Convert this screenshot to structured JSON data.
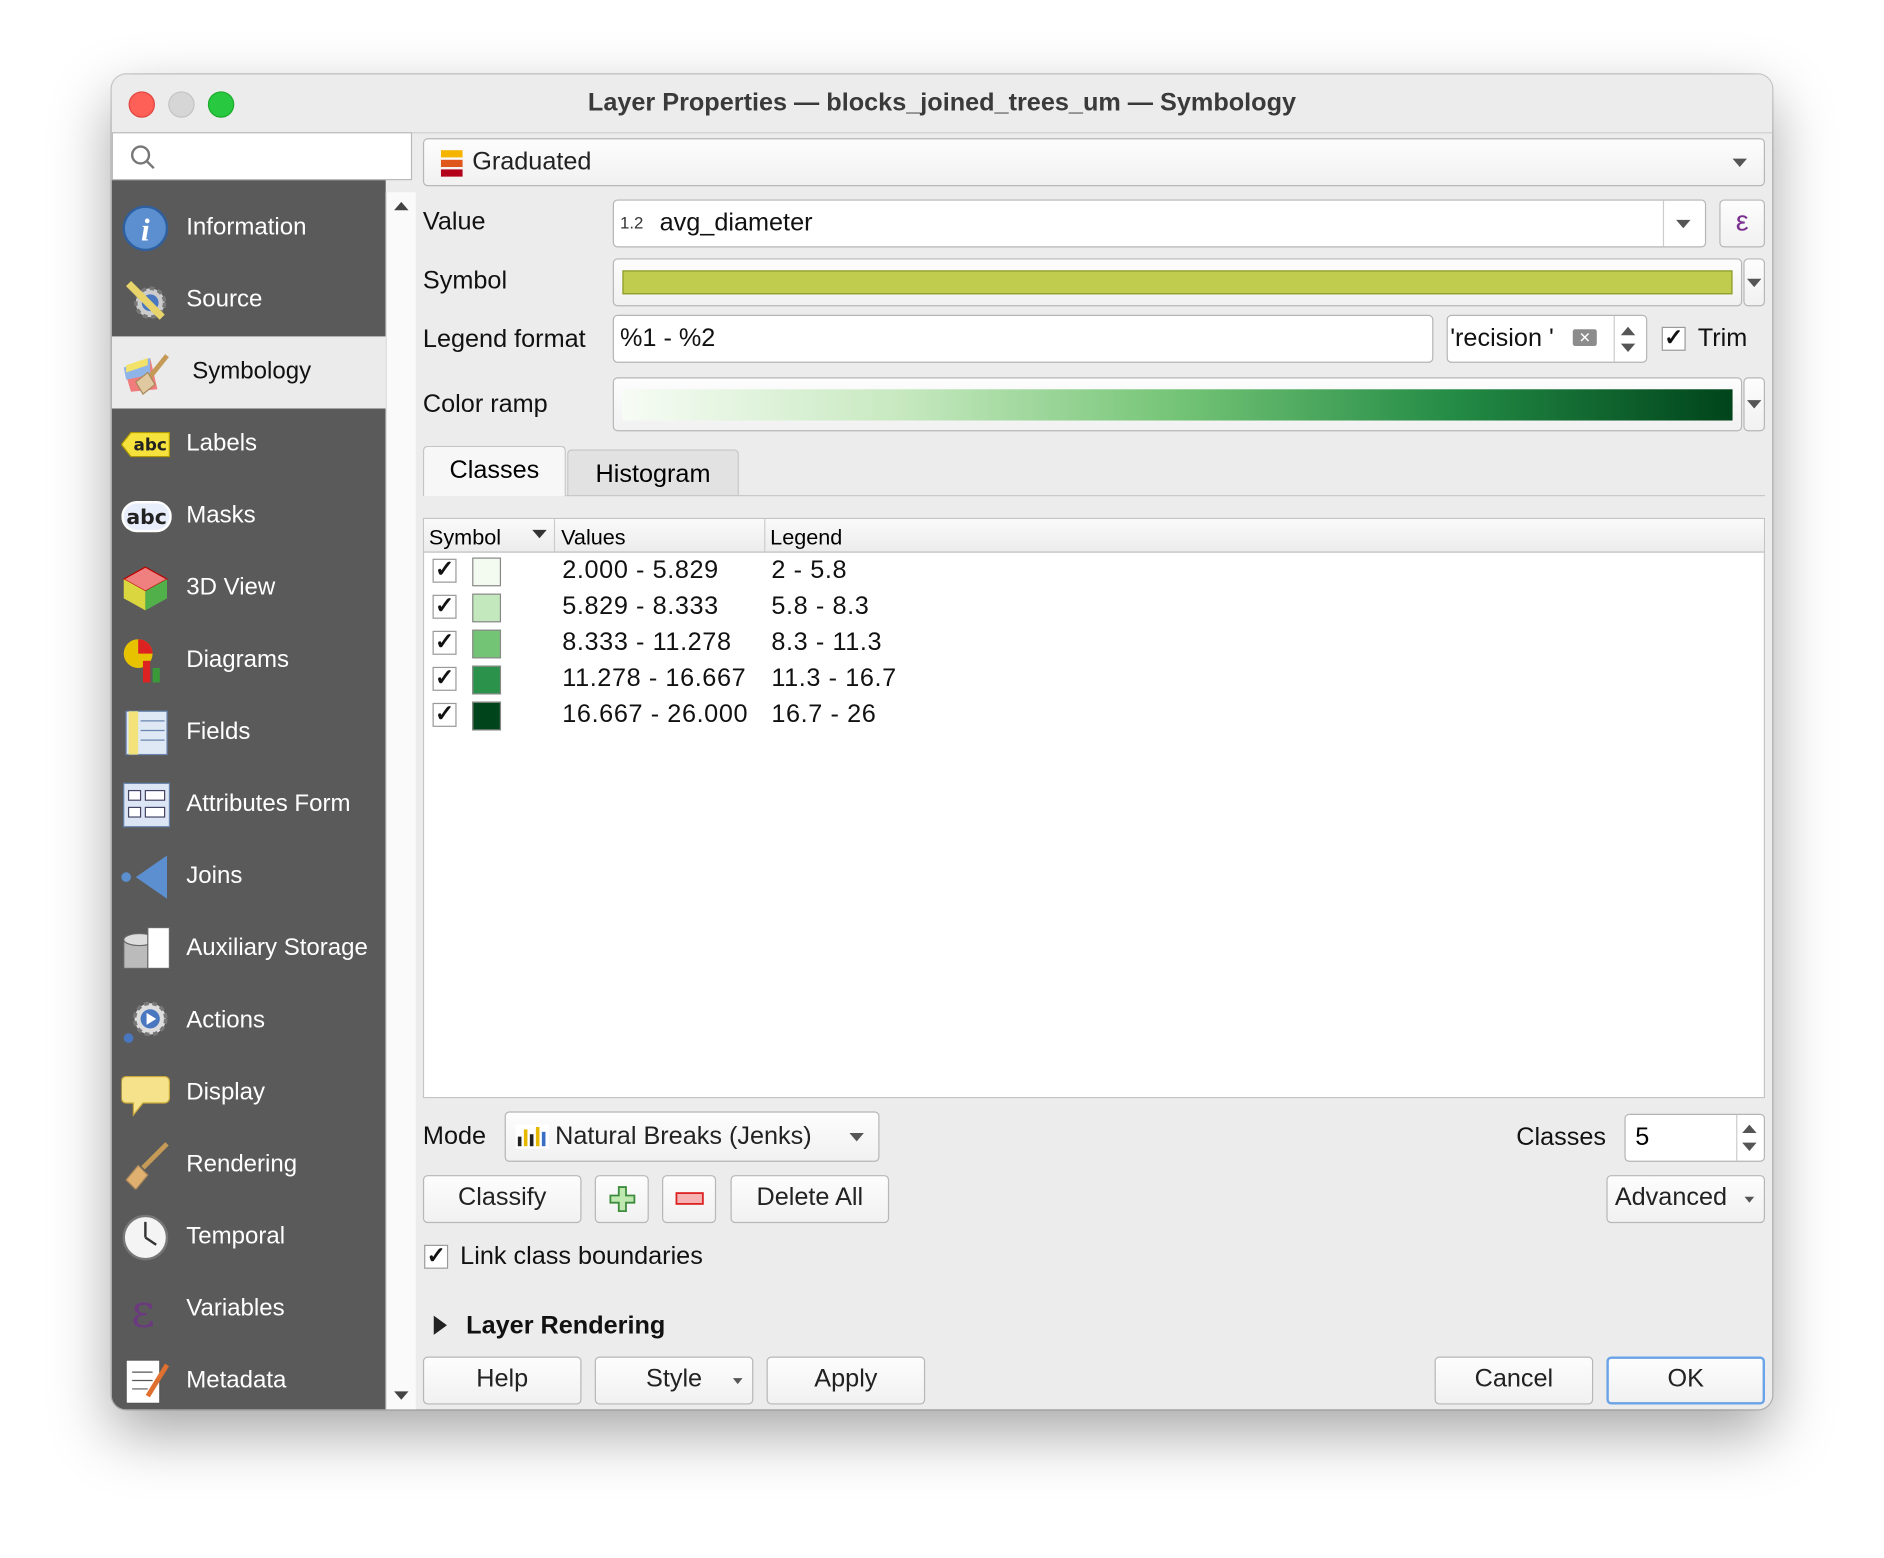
{
  "window": {
    "title": "Layer Properties — blocks_joined_trees_um — Symbology"
  },
  "search": {
    "placeholder": ""
  },
  "sidebar": {
    "items": [
      {
        "label": "Information",
        "icon": "info-icon"
      },
      {
        "label": "Source",
        "icon": "wrench-gear-icon"
      },
      {
        "label": "Symbology",
        "icon": "paintbrush-icon",
        "selected": true
      },
      {
        "label": "Labels",
        "icon": "abc-label-icon"
      },
      {
        "label": "Masks",
        "icon": "abc-mask-icon"
      },
      {
        "label": "3D View",
        "icon": "cube-icon"
      },
      {
        "label": "Diagrams",
        "icon": "diagram-icon"
      },
      {
        "label": "Fields",
        "icon": "fields-icon"
      },
      {
        "label": "Attributes Form",
        "icon": "form-icon"
      },
      {
        "label": "Joins",
        "icon": "joins-icon"
      },
      {
        "label": "Auxiliary Storage",
        "icon": "database-icon"
      },
      {
        "label": "Actions",
        "icon": "actions-gear-icon"
      },
      {
        "label": "Display",
        "icon": "speech-bubble-icon"
      },
      {
        "label": "Rendering",
        "icon": "brush-icon"
      },
      {
        "label": "Temporal",
        "icon": "clock-icon"
      },
      {
        "label": "Variables",
        "icon": "epsilon-icon"
      },
      {
        "label": "Metadata",
        "icon": "document-pencil-icon"
      }
    ]
  },
  "renderer": {
    "selected": "Graduated"
  },
  "value": {
    "label": "Value",
    "type_badge": "1.2",
    "field": "avg_diameter",
    "expression_glyph": "ε"
  },
  "symbol": {
    "label": "Symbol",
    "color": "#c0cc4e"
  },
  "legend_format": {
    "label": "Legend format",
    "value": "%1 - %2",
    "precision_text": "'recision '",
    "trim_label": "Trim",
    "trim_checked": true
  },
  "color_ramp": {
    "label": "Color ramp",
    "colors": [
      "#f7fcf5",
      "#c7e9c0",
      "#74c476",
      "#238b45",
      "#00441b"
    ]
  },
  "tabs": [
    {
      "label": "Classes",
      "active": true
    },
    {
      "label": "Histogram",
      "active": false
    }
  ],
  "table": {
    "headers": [
      "Symbol",
      "Values",
      "Legend"
    ],
    "rows": [
      {
        "checked": true,
        "color": "#f3faf0",
        "values": "2.000 - 5.829",
        "legend": "2 - 5.8"
      },
      {
        "checked": true,
        "color": "#c4e8bd",
        "values": "5.829 - 8.333",
        "legend": "5.8 - 8.3"
      },
      {
        "checked": true,
        "color": "#74c476",
        "values": "8.333 - 11.278",
        "legend": "8.3 - 11.3"
      },
      {
        "checked": true,
        "color": "#2a924a",
        "values": "11.278 - 16.667",
        "legend": "11.3 - 16.7"
      },
      {
        "checked": true,
        "color": "#00441b",
        "values": "16.667 - 26.000",
        "legend": "16.7 - 26"
      }
    ]
  },
  "mode": {
    "label": "Mode",
    "selected": "Natural Breaks (Jenks)"
  },
  "classes": {
    "label": "Classes",
    "value": "5"
  },
  "buttons": {
    "classify": "Classify",
    "delete_all": "Delete All",
    "advanced": "Advanced",
    "help": "Help",
    "style": "Style",
    "apply": "Apply",
    "cancel": "Cancel",
    "ok": "OK"
  },
  "link_boundaries": {
    "label": "Link class boundaries",
    "checked": true
  },
  "layer_rendering": {
    "label": "Layer Rendering"
  }
}
